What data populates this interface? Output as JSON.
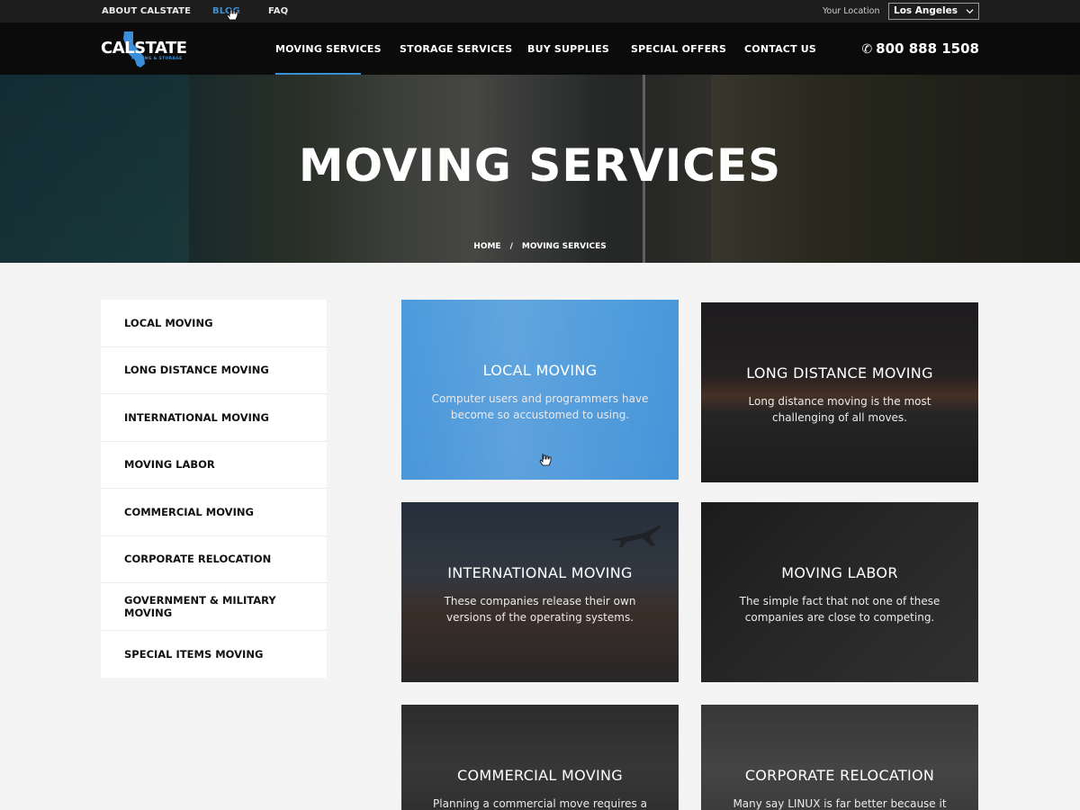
{
  "topbar": {
    "links": [
      "ABOUT CALSTATE",
      "BLOG",
      "FAQ"
    ],
    "location_label": "Your Location",
    "location_value": "Los Angeles"
  },
  "brand": {
    "name": "CALSTATE",
    "tagline": "MOVING & STORAGE"
  },
  "nav": {
    "items": [
      "MOVING SERVICES",
      "STORAGE SERVICES",
      "BUY SUPPLIES",
      "SPECIAL OFFERS",
      "CONTACT US"
    ],
    "active": "MOVING SERVICES",
    "phone": "800 888 1508"
  },
  "hero": {
    "title": "MOVING SERVICES",
    "breadcrumb": [
      "HOME",
      "/",
      "MOVING SERVICES"
    ]
  },
  "sidebar": {
    "items": [
      "LOCAL MOVING",
      "LONG DISTANCE MOVING",
      "INTERNATIONAL MOVING",
      "MOVING LABOR",
      "COMMERCIAL MOVING",
      "CORPORATE RELOCATION",
      "GOVERNMENT & MILITARY MOVING",
      "SPECIAL ITEMS MOVING"
    ]
  },
  "cards": [
    {
      "title": "LOCAL MOVING",
      "desc": "Computer users and programmers have become so accustomed to using."
    },
    {
      "title": "LONG DISTANCE MOVING",
      "desc": "Long distance moving is the most challenging of all moves."
    },
    {
      "title": "INTERNATIONAL MOVING",
      "desc": "These companies release their own versions of the operating systems."
    },
    {
      "title": "MOVING LABOR",
      "desc": "The simple fact that not one of these companies are close to competing."
    },
    {
      "title": "COMMERCIAL MOVING",
      "desc": "Planning a commercial move requires a"
    },
    {
      "title": "CORPORATE RELOCATION",
      "desc": "Many say LINUX is far better because it"
    }
  ],
  "colors": {
    "accent": "#3b8fd8",
    "topbar_bg": "#1d1d1d",
    "nav_bg": "#0b0b0b",
    "page_bg": "#f4f4f4"
  }
}
